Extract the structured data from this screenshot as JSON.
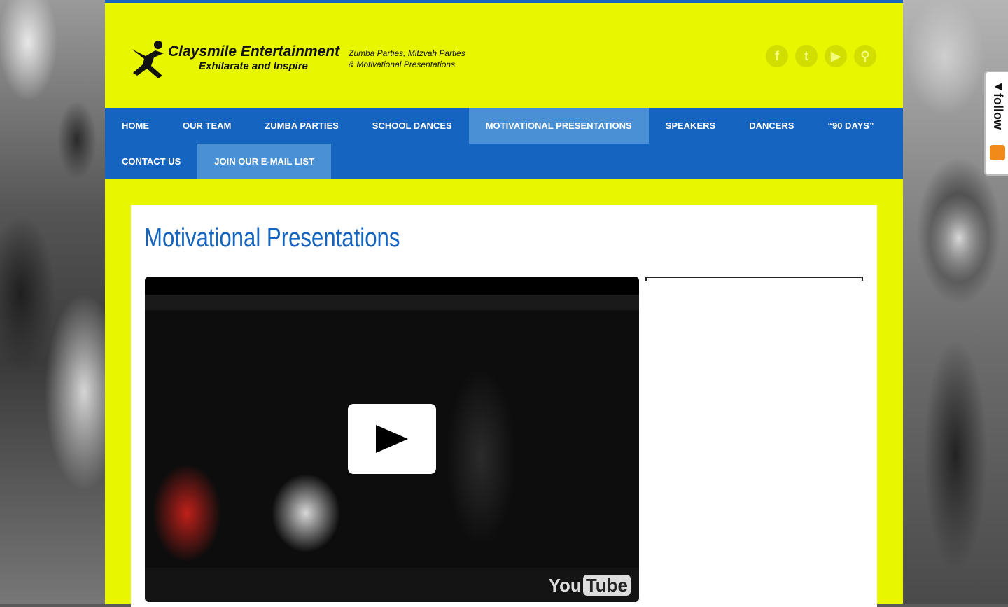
{
  "brand": {
    "name": "Claysmile Entertainment",
    "tagline": "Exhilarate and Inspire",
    "subtitle_line1": "Zumba Parties, Mitzvah Parties",
    "subtitle_line2": "& Motivational Presentations"
  },
  "social": [
    {
      "icon": "facebook-icon",
      "glyph": "f"
    },
    {
      "icon": "twitter-icon",
      "glyph": "t"
    },
    {
      "icon": "youtube-icon",
      "glyph": "▶"
    },
    {
      "icon": "search-icon",
      "glyph": "⚲"
    }
  ],
  "nav": {
    "row1": [
      "HOME",
      "OUR TEAM",
      "ZUMBA PARTIES",
      "SCHOOL DANCES",
      "MOTIVATIONAL PRESENTATIONS",
      "SPEAKERS",
      "DANCERS",
      "“90 DAYS”"
    ],
    "row2": [
      "CONTACT US",
      "JOIN OUR E-MAIL LIST"
    ],
    "active": "MOTIVATIONAL PRESENTATIONS"
  },
  "page": {
    "title": "Motivational Presentations"
  },
  "video": {
    "provider_you": "You",
    "provider_tube": "Tube"
  },
  "follow": {
    "label": "◄follow"
  },
  "colors": {
    "page_bg": "#e8f700",
    "nav_bg": "#1565c0",
    "nav_active": "#4a90d4",
    "title": "#1565c0"
  }
}
